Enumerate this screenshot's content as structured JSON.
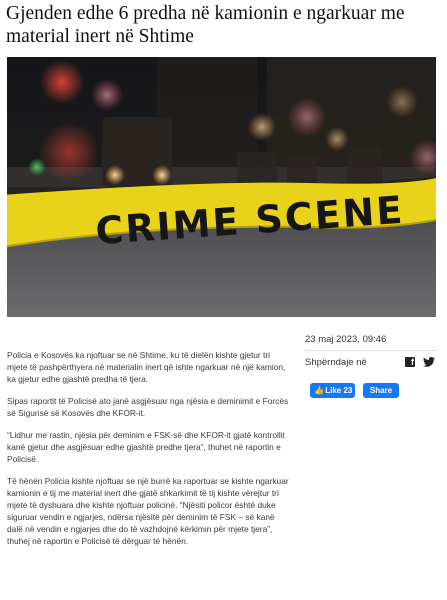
{
  "article": {
    "title": "Gjenden edhe 6 predha në kamionin e ngarkuar me material inert në Shtime",
    "date": "23 maj 2023, 09:46",
    "paragraphs": [
      "Policia e Kosovës ka njoftuar se në Shtime, ku të dielën kishte gjetur tri mjete të pashpërthyera në materialin inert që ishte ngarkuar në një kamion, ka gjetur edhe gjashtë predha të tjera.",
      "Sipas raportit të Policisë ato janë asgjësuar nga njësia e deminimit e Forcës së Sigurisë së Kosovës dhe KFOR-it.",
      "“Lidhur me rastin, njësia për deminim e FSK-së dhe KFOR-it gjatë kontrollit kanë gjetur dhe asgjësuar edhe gjashtë predhe tjera”, thuhet në raportin e Policisë.",
      "Të hënën Policia kishte njoftuar se një burrë ka raportuar se kishte ngarkuar kamionin e tij me material inert dhe gjatë shkarkimit të tij kishte vërejtur tri mjete të dyshuara dhe kishte njoftuar policinë. “Njësiti policor është duke siguruar vendin e ngjarjes, ndërsa njësitë për deminim të FSK – së kanë dalë në vendin e ngjarjes dhe do të vazhdojnë kërkimin për mjete tjera”, thuhej në raportin e Policisë të dërguar të hënën."
    ]
  },
  "hero_image": {
    "tape_text": "CRIME SCENE"
  },
  "share": {
    "label": "Shpërndaje në",
    "facebook_icon": "facebook-icon",
    "twitter_icon": "twitter-icon",
    "like_label": "Like 23",
    "share_button": "Share"
  },
  "colors": {
    "facebook_blue": "#1877f2",
    "tape_yellow": "#e9d21a"
  }
}
